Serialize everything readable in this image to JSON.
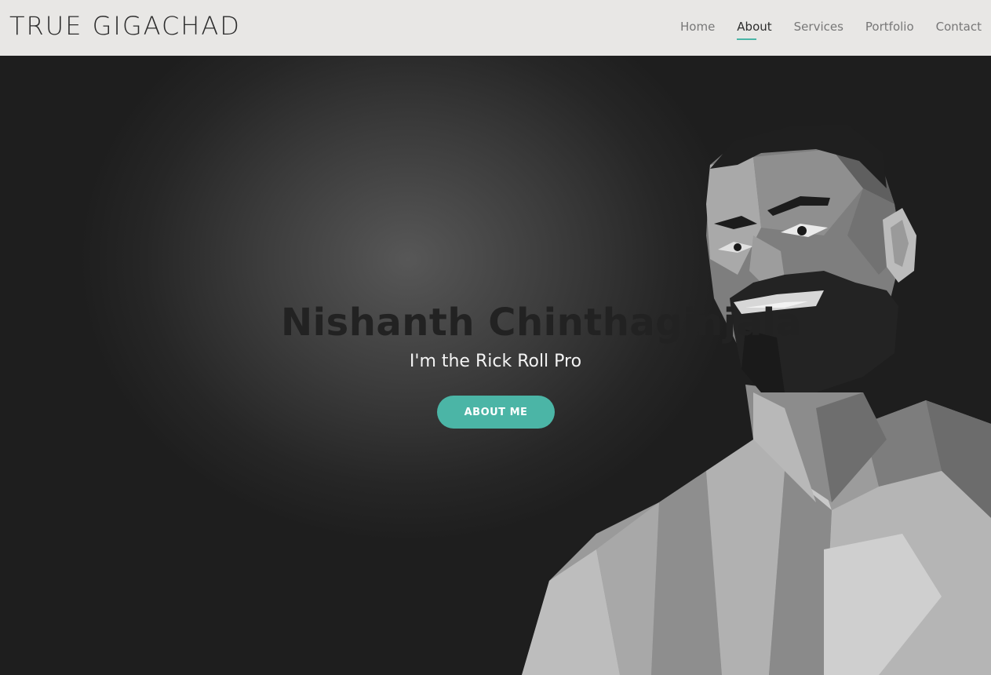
{
  "brand": "TRUE GIGACHAD",
  "nav": {
    "items": [
      "Home",
      "About",
      "Services",
      "Portfolio",
      "Contact"
    ],
    "active": "About"
  },
  "hero": {
    "title": "Nishanth Chinthaginjala",
    "subtitle": "I'm the Rick Roll Pro",
    "button_label": "ABOUT ME"
  },
  "colors": {
    "accent": "#4bb5a6",
    "navbar_bg": "#e8e7e5",
    "hero_bg": "#2a2a2a"
  },
  "icons": {
    "hero_image": "low-poly-bearded-man-portrait"
  }
}
